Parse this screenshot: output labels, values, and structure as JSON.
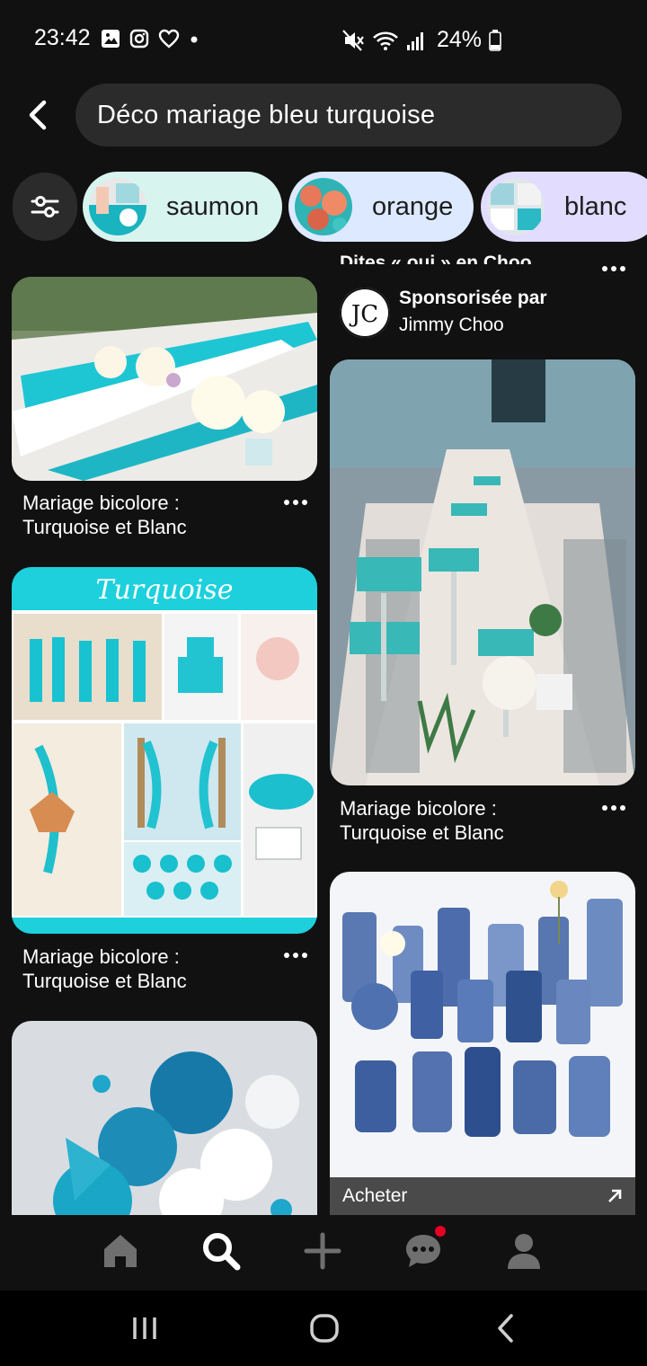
{
  "status": {
    "time": "23:42",
    "battery": "24%"
  },
  "search": {
    "query": "Déco mariage bleu turquoise"
  },
  "chips": [
    {
      "label": "saumon",
      "bg": "#d8f4ef"
    },
    {
      "label": "orange",
      "bg": "#dde9ff"
    },
    {
      "label": "blanc",
      "bg": "#e2dcff"
    }
  ],
  "feed": {
    "pins_left": [
      {
        "title": "Mariage bicolore : Turquoise et Blanc"
      },
      {
        "title": "Mariage bicolore : Turquoise et Blanc",
        "image_text": "Turquoise"
      }
    ],
    "sponsored": {
      "title": "Dites « oui » en Choo.",
      "sponsored_by": "Sponsorisée par",
      "advertiser": "Jimmy Choo"
    },
    "pins_right": [
      {
        "title": "Mariage bicolore : Turquoise et Blanc"
      }
    ],
    "buy_label": "Acheter"
  },
  "nav": {
    "items": [
      "home-icon",
      "search-icon",
      "plus-icon",
      "messages-icon",
      "profile-icon"
    ]
  },
  "colors": {
    "background": "#111111",
    "turquoise": "#1ec6d3",
    "notification": "#e60023"
  }
}
